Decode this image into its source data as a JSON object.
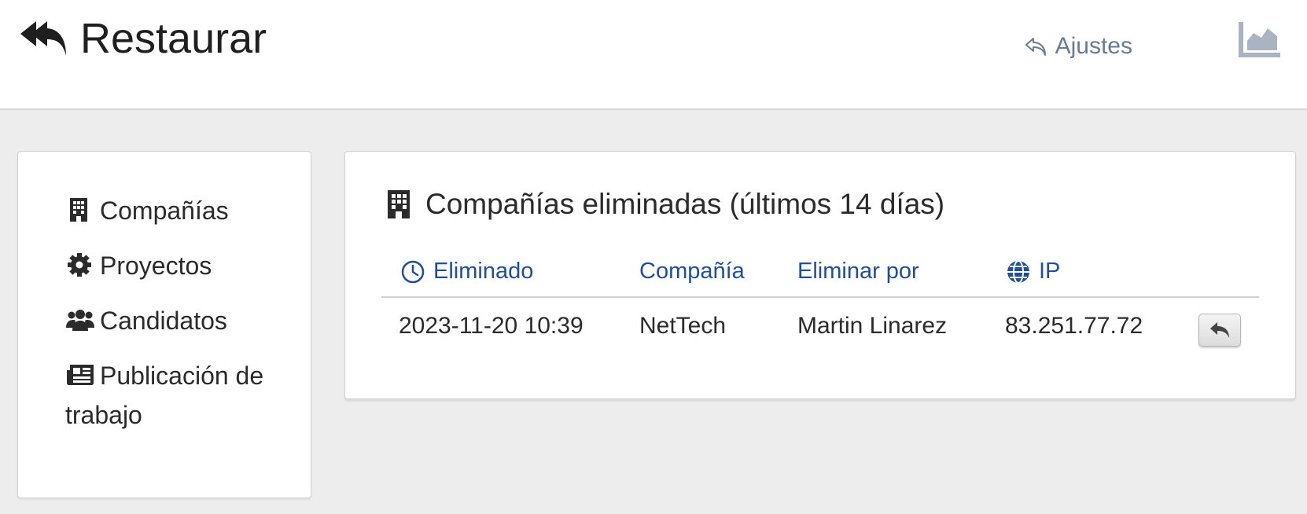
{
  "header": {
    "title": "Restaurar",
    "title_icon": "double-reply-icon",
    "settings_label": "Ajustes",
    "settings_icon": "reply-outline-icon",
    "chart_icon": "area-chart-icon"
  },
  "sidebar": {
    "items": [
      {
        "label": "Compañías",
        "icon": "building-icon"
      },
      {
        "label": "Proyectos",
        "icon": "gear-icon"
      },
      {
        "label": "Candidatos",
        "icon": "users-icon"
      },
      {
        "label": "Publicación de trabajo",
        "icon": "newspaper-icon"
      }
    ]
  },
  "main": {
    "title": "Compañías eliminadas (últimos 14 días)",
    "title_icon": "building-icon",
    "columns": [
      {
        "label": "Eliminado",
        "icon": "clock-icon"
      },
      {
        "label": "Compañía"
      },
      {
        "label": "Eliminar por"
      },
      {
        "label": "IP",
        "icon": "globe-icon"
      }
    ],
    "rows": [
      {
        "deleted": "2023-11-20 10:39",
        "company": "NetTech",
        "deleted_by": "Martin Linarez",
        "ip": "83.251.77.72",
        "action_icon": "reply-icon"
      }
    ]
  },
  "colors": {
    "link": "#1f4e9a",
    "muted": "#6b7a90",
    "background": "#ededed"
  }
}
